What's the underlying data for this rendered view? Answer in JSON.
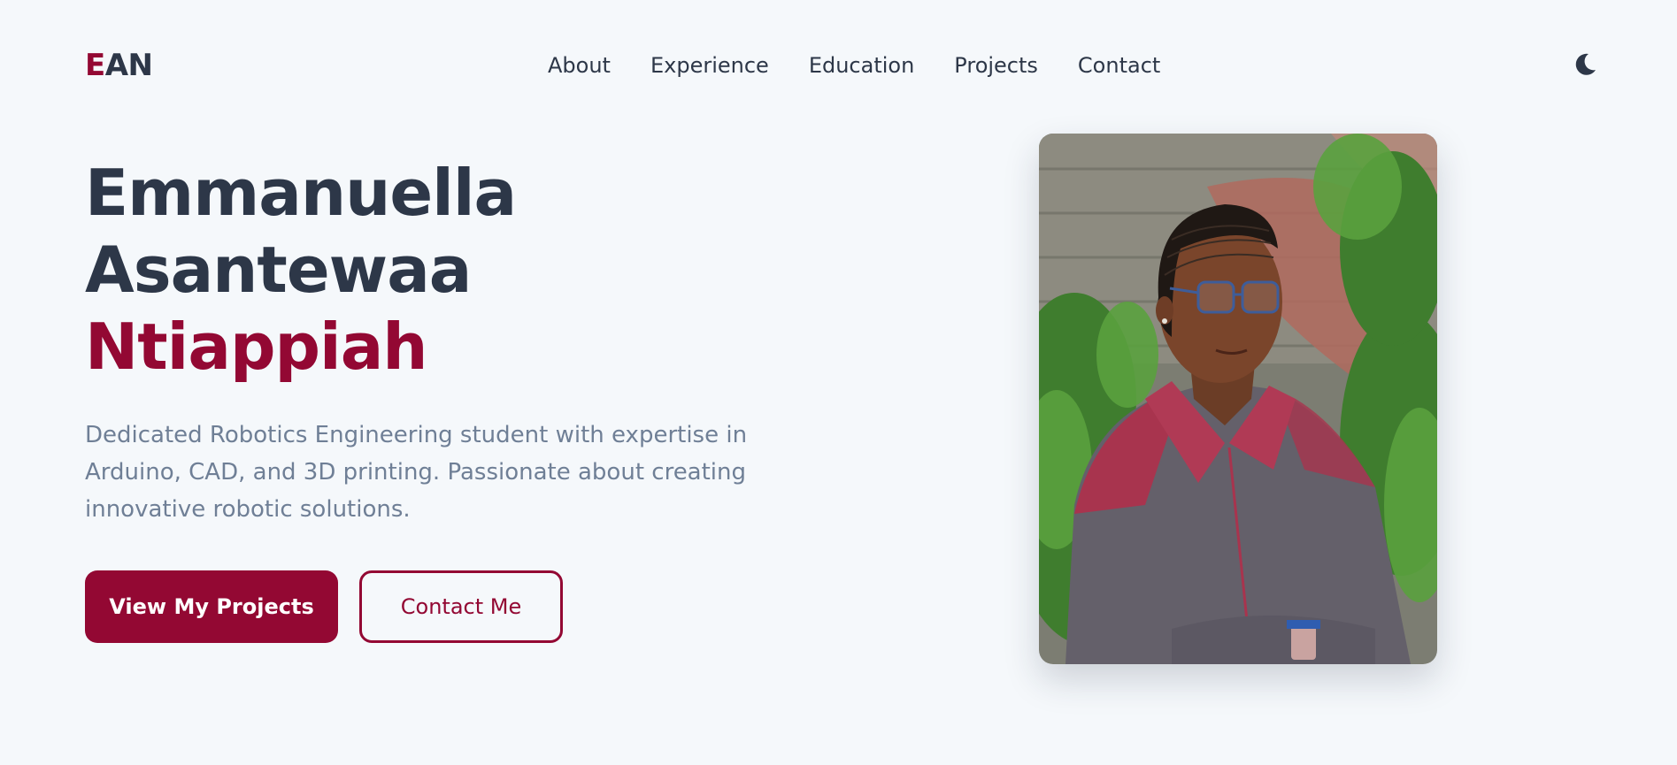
{
  "logo": {
    "first": "E",
    "rest": "AN"
  },
  "nav": {
    "items": [
      {
        "label": "About"
      },
      {
        "label": "Experience"
      },
      {
        "label": "Education"
      },
      {
        "label": "Projects"
      },
      {
        "label": "Contact"
      }
    ],
    "theme_icon": "moon-icon"
  },
  "hero": {
    "name_line1": "Emmanuella",
    "name_line2": "Asantewaa",
    "name_line3": "Ntiappiah",
    "description": "Dedicated Robotics Engineering student with expertise in Arduino, CAD, and 3D printing. Passionate about creating innovative robotic solutions.",
    "primary_button": "View My Projects",
    "secondary_button": "Contact Me"
  },
  "colors": {
    "accent": "#930833",
    "text": "#2d3748",
    "muted": "#6f7f96",
    "background": "#f5f8fb"
  }
}
